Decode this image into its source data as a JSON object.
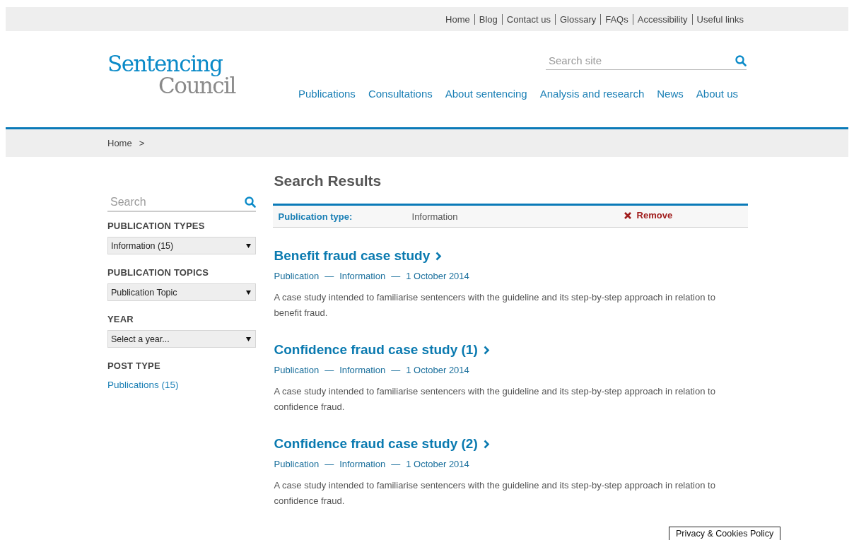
{
  "top_links": [
    "Home",
    "Blog",
    "Contact us",
    "Glossary",
    "FAQs",
    "Accessibility",
    "Useful links"
  ],
  "logo": {
    "line_1": "Sentencing",
    "line_2": "Council"
  },
  "site_search": {
    "placeholder": "Search site"
  },
  "nav": [
    "Publications",
    "Consultations",
    "About sentencing",
    "Analysis and research",
    "News",
    "About us"
  ],
  "breadcrumb": [
    "Home",
    ">"
  ],
  "sidebar": {
    "search": {
      "placeholder": "Search"
    },
    "filters": [
      {
        "heading": "PUBLICATION TYPES",
        "value": "Information (15)"
      },
      {
        "heading": "PUBLICATION TOPICS",
        "value": "Publication Topic"
      },
      {
        "heading": "YEAR",
        "value": "Select a year..."
      }
    ],
    "post_type": {
      "heading": "POST TYPE",
      "links": [
        "Publications (15)"
      ]
    }
  },
  "results": {
    "title": "Search Results",
    "active_filter": {
      "label": "Publication type:",
      "value": "Information",
      "remove": "Remove"
    },
    "items": [
      {
        "title": "Benefit fraud case study",
        "meta": [
          "Publication",
          "Information",
          "1 October 2014"
        ],
        "separator": "—",
        "summary": "A case study intended to familiarise sentencers with the guideline and its step-by-step approach in relation to benefit fraud."
      },
      {
        "title": "Confidence fraud case study (1)",
        "meta": [
          "Publication",
          "Information",
          "1 October 2014"
        ],
        "separator": "—",
        "summary": "A case study intended to familiarise sentencers with the guideline and its step-by-step approach in relation to confidence fraud."
      },
      {
        "title": "Confidence fraud case study (2)",
        "meta": [
          "Publication",
          "Information",
          "1 October 2014"
        ],
        "separator": "—",
        "summary": "A case study intended to familiarise sentencers with the guideline and its step-by-step approach in relation to confidence fraud."
      }
    ]
  },
  "cookie_badge": "Privacy & Cookies Policy"
}
